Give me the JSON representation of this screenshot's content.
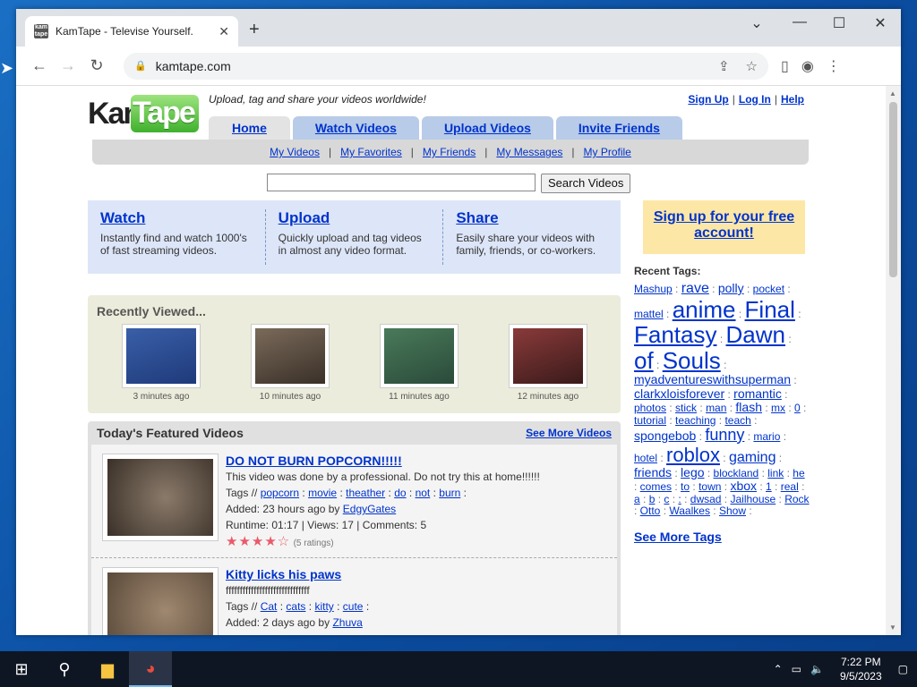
{
  "browser": {
    "tab_title": "KamTape - Televise Yourself.",
    "tab_close": "✕",
    "new_tab": "+",
    "url": "kamtape.com"
  },
  "site": {
    "logo_kam": "Kam",
    "logo_tape": "Tape",
    "tagline": "Upload, tag and share your videos worldwide!",
    "top_links": [
      "Sign Up",
      "Log In",
      "Help"
    ],
    "nav_tabs": [
      "Home",
      "Watch Videos",
      "Upload Videos",
      "Invite Friends"
    ],
    "sub_nav": [
      "My Videos",
      "My Favorites",
      "My Friends",
      "My Messages",
      "My Profile"
    ],
    "search_button": "Search Videos",
    "intro": [
      {
        "title": "Watch",
        "text": "Instantly find and watch 1000's of fast streaming videos."
      },
      {
        "title": "Upload",
        "text": "Quickly upload and tag videos in almost any video format."
      },
      {
        "title": "Share",
        "text": "Easily share your videos with family, friends, or co-workers."
      }
    ],
    "signup_box": "Sign up for your free account!",
    "recently_viewed": {
      "heading": "Recently Viewed...",
      "items": [
        {
          "time": "3 minutes ago",
          "colors": [
            "#3a5fa8",
            "#1e3a7a"
          ]
        },
        {
          "time": "10 minutes ago",
          "colors": [
            "#7a6a5a",
            "#3a3028"
          ]
        },
        {
          "time": "11 minutes ago",
          "colors": [
            "#4a7a5a",
            "#2a4a3a"
          ]
        },
        {
          "time": "12 minutes ago",
          "colors": [
            "#8a3a3a",
            "#3a1a1a"
          ]
        }
      ]
    },
    "featured": {
      "heading": "Today's Featured Videos",
      "see_more": "See More Videos",
      "videos": [
        {
          "title": "DO NOT BURN POPCORN!!!!!",
          "description": "This video was done by a professional. Do not try this at home!!!!!!",
          "tags_label": "Tags //",
          "tags": [
            "popcorn",
            "movie",
            "theather",
            "do",
            "not",
            "burn"
          ],
          "added_prefix": "Added: 23 hours ago by",
          "author": "EdgyGates",
          "stats": "Runtime: 01:17 | Views: 17 | Comments: 5",
          "stars": "★★★★☆",
          "ratings": "(5 ratings)",
          "colors": [
            "#8a7a6a",
            "#3a3028"
          ]
        },
        {
          "title": "Kitty licks his paws",
          "description": "ffffffffffffffffffffffffffffff",
          "tags_label": "Tags //",
          "tags": [
            "Cat",
            "cats",
            "kitty",
            "cute"
          ],
          "added_prefix": "Added: 2 days ago by",
          "author": "Zhuva",
          "stats": "",
          "stars": "",
          "ratings": "",
          "colors": [
            "#a08870",
            "#5a4a3a"
          ]
        }
      ]
    },
    "recent_tags": {
      "heading": "Recent Tags:",
      "tags": [
        {
          "t": "Mashup",
          "s": 12
        },
        {
          "t": "rave",
          "s": 16
        },
        {
          "t": "polly",
          "s": 14
        },
        {
          "t": "pocket",
          "s": 12
        },
        {
          "t": "mattel",
          "s": 12
        },
        {
          "t": "anime",
          "s": 26
        },
        {
          "t": "Final",
          "s": 26
        },
        {
          "t": "Fantasy",
          "s": 26
        },
        {
          "t": "Dawn",
          "s": 26
        },
        {
          "t": "of",
          "s": 26
        },
        {
          "t": "Souls",
          "s": 26
        },
        {
          "t": "myadventureswithsuperman",
          "s": 14
        },
        {
          "t": "clarkxloisforever",
          "s": 14
        },
        {
          "t": "romantic",
          "s": 14
        },
        {
          "t": "photos",
          "s": 12
        },
        {
          "t": "stick",
          "s": 12
        },
        {
          "t": "man",
          "s": 12
        },
        {
          "t": "flash",
          "s": 14
        },
        {
          "t": "mx",
          "s": 12
        },
        {
          "t": "0",
          "s": 12
        },
        {
          "t": "tutorial",
          "s": 12
        },
        {
          "t": "teaching",
          "s": 12
        },
        {
          "t": "teach",
          "s": 12
        },
        {
          "t": "spongebob",
          "s": 14
        },
        {
          "t": "funny",
          "s": 18
        },
        {
          "t": "mario",
          "s": 12
        },
        {
          "t": "hotel",
          "s": 12
        },
        {
          "t": "roblox",
          "s": 22
        },
        {
          "t": "gaming",
          "s": 16
        },
        {
          "t": "friends",
          "s": 14
        },
        {
          "t": "lego",
          "s": 14
        },
        {
          "t": "blockland",
          "s": 12
        },
        {
          "t": "link",
          "s": 12
        },
        {
          "t": "he",
          "s": 12
        },
        {
          "t": "comes",
          "s": 12
        },
        {
          "t": "to",
          "s": 12
        },
        {
          "t": "town",
          "s": 12
        },
        {
          "t": "xbox",
          "s": 14
        },
        {
          "t": "1",
          "s": 12
        },
        {
          "t": "real",
          "s": 12
        },
        {
          "t": "a",
          "s": 12
        },
        {
          "t": "b",
          "s": 12
        },
        {
          "t": "c",
          "s": 12
        },
        {
          "t": ":",
          "s": 12
        },
        {
          "t": "dwsad",
          "s": 12
        },
        {
          "t": "Jailhouse",
          "s": 12
        },
        {
          "t": "Rock",
          "s": 12
        },
        {
          "t": "Otto",
          "s": 12
        },
        {
          "t": "Waalkes",
          "s": 12
        },
        {
          "t": "Show",
          "s": 12
        }
      ],
      "see_more": "See More Tags"
    }
  },
  "taskbar": {
    "time": "7:22 PM",
    "date": "9/5/2023"
  }
}
